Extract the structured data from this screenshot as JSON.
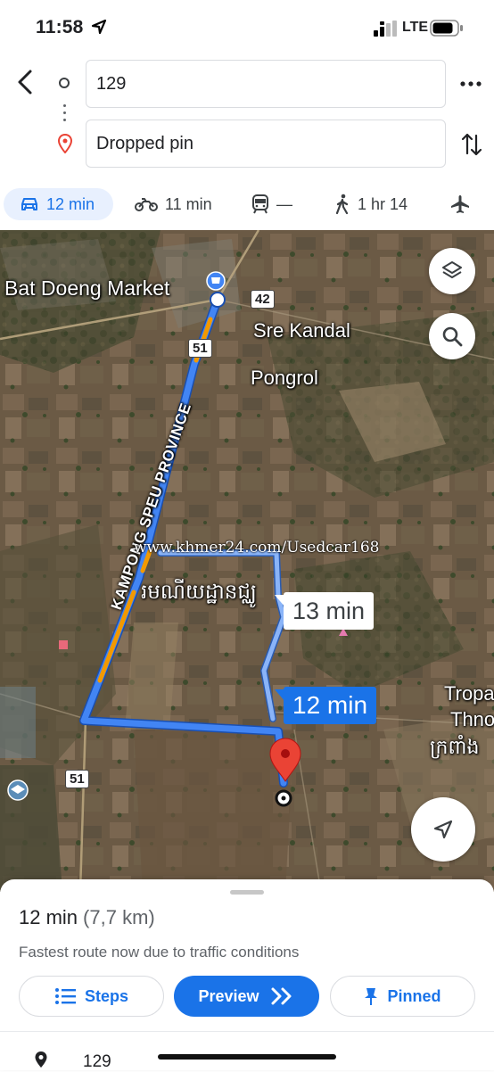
{
  "status_bar": {
    "time": "11:58",
    "network": "LTE"
  },
  "search": {
    "origin": "129",
    "destination": "Dropped pin"
  },
  "travel_modes": [
    {
      "mode": "drive",
      "label": "12 min",
      "icon": "car-icon",
      "selected": true
    },
    {
      "mode": "motorcycle",
      "label": "11 min",
      "icon": "motorcycle-icon"
    },
    {
      "mode": "transit",
      "label": "—",
      "icon": "train-icon"
    },
    {
      "mode": "walk",
      "label": "1 hr 14",
      "icon": "walk-icon"
    },
    {
      "mode": "flight",
      "label": "",
      "icon": "airplane-icon"
    }
  ],
  "map": {
    "labels": {
      "market": "Bat Doeng Market",
      "sre_kandal": "Sre Kandal",
      "pongrol": "Pongrol",
      "province": "KAMPONG SPEU PROVINCE",
      "tropa": "Tropa",
      "thno": "Thno",
      "khmer_1": "រមណីយដ្ឋានជ្ឈូ",
      "khmer_2": "ក្រពាំង"
    },
    "road_shields": [
      "42",
      "51",
      "51"
    ],
    "watermark": "www.khmer24.com/Usedcar168",
    "route_alt_time": "13 min",
    "route_main_time": "12 min",
    "colors": {
      "route": "#4285f4",
      "route_alt": "#8ab4f8",
      "traffic": "#f29900",
      "pin": "#ea4335"
    }
  },
  "sheet": {
    "duration": "12 min",
    "distance": "(7,7 km)",
    "note": "Fastest route now due to traffic conditions",
    "buttons": {
      "steps": "Steps",
      "preview": "Preview",
      "pinned": "Pinned"
    },
    "first_step": "129"
  }
}
